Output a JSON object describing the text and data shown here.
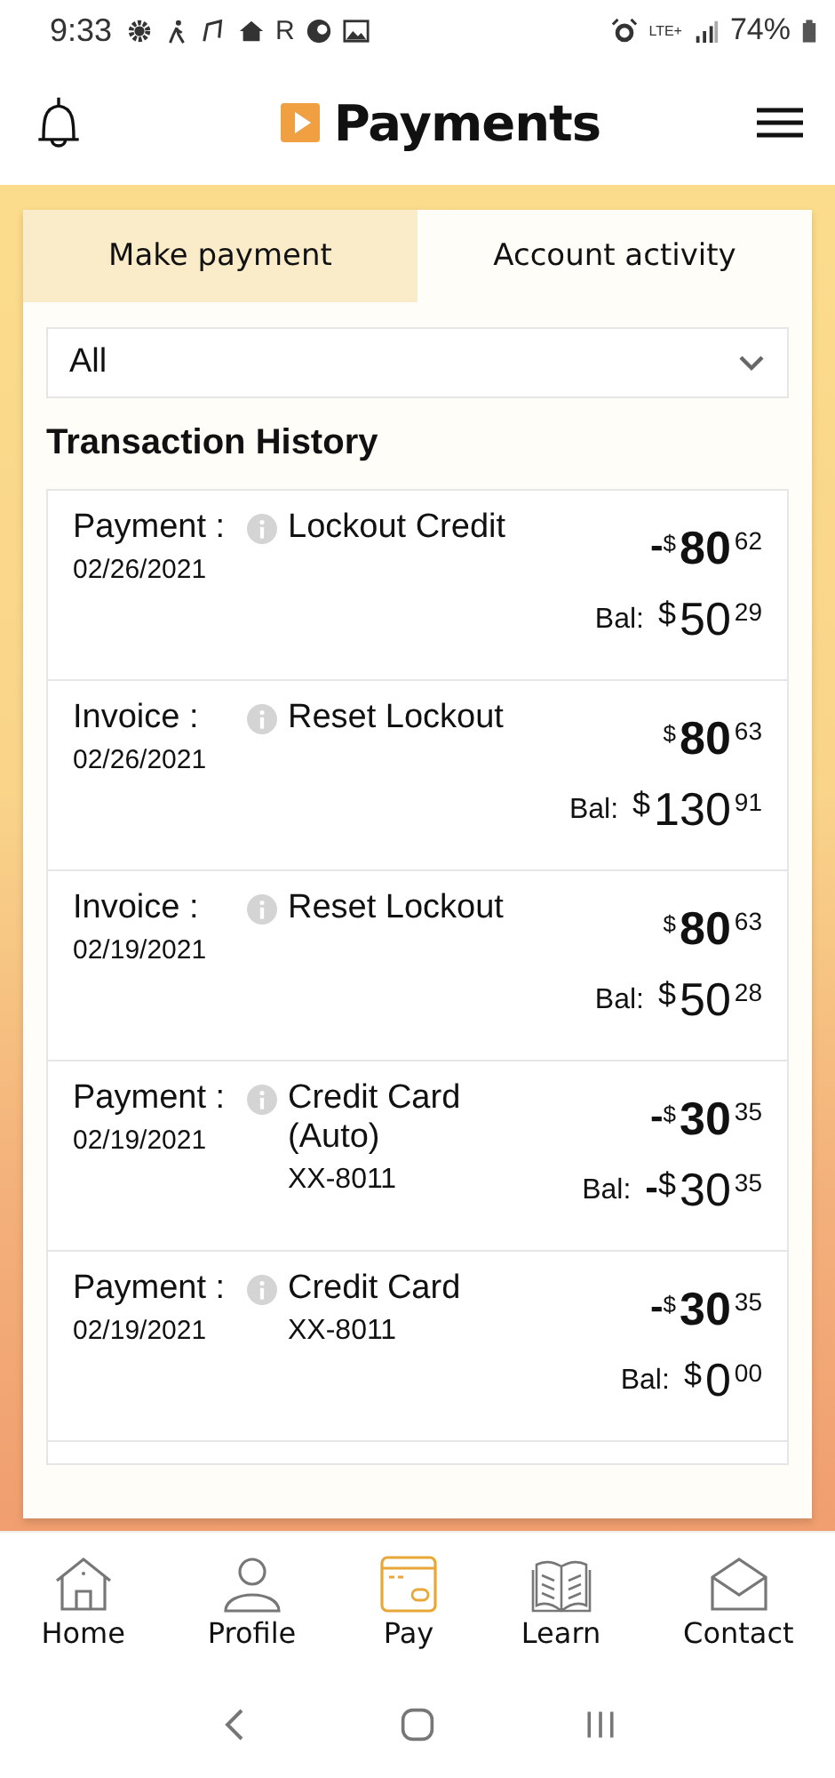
{
  "status_bar": {
    "time": "9:33",
    "carrier_letter": "R",
    "network": "LTE+",
    "battery": "74%"
  },
  "header": {
    "title": "Payments"
  },
  "tabs": [
    {
      "label": "Make payment",
      "selected": false
    },
    {
      "label": "Account activity",
      "selected": true
    }
  ],
  "filter": {
    "value": "All"
  },
  "section_title": "Transaction History",
  "transactions": [
    {
      "type": "Payment :",
      "date": "02/26/2021",
      "description": [
        "Lockout Credit"
      ],
      "amount": {
        "sign": "-",
        "currency": "$",
        "whole": "80",
        "cents": "62"
      },
      "balance_label": "Bal:",
      "balance": {
        "currency": "$",
        "whole": "50",
        "cents": "29"
      }
    },
    {
      "type": "Invoice :",
      "date": "02/26/2021",
      "description": [
        "Reset Lockout"
      ],
      "amount": {
        "currency": "$",
        "whole": "80",
        "cents": "63"
      },
      "balance_label": "Bal:",
      "balance": {
        "currency": "$",
        "whole": "130",
        "cents": "91"
      }
    },
    {
      "type": "Invoice :",
      "date": "02/19/2021",
      "description": [
        "Reset Lockout"
      ],
      "amount": {
        "currency": "$",
        "whole": "80",
        "cents": "63"
      },
      "balance_label": "Bal:",
      "balance": {
        "currency": "$",
        "whole": "50",
        "cents": "28"
      }
    },
    {
      "type": "Payment :",
      "date": "02/19/2021",
      "description": [
        "Credit Card",
        "(Auto)",
        "XX-8011"
      ],
      "amount": {
        "sign": "-",
        "currency": "$",
        "whole": "30",
        "cents": "35"
      },
      "balance_label": "Bal:",
      "balance": {
        "sign": "-",
        "currency": "$",
        "whole": "30",
        "cents": "35"
      }
    },
    {
      "type": "Payment :",
      "date": "02/19/2021",
      "description": [
        "Credit Card",
        "XX-8011"
      ],
      "amount": {
        "sign": "-",
        "currency": "$",
        "whole": "30",
        "cents": "35"
      },
      "balance_label": "Bal:",
      "balance": {
        "currency": "$",
        "whole": "0",
        "cents": "00"
      }
    }
  ],
  "bottom_nav": [
    {
      "label": "Home",
      "selected": false
    },
    {
      "label": "Profile",
      "selected": false
    },
    {
      "label": "Pay",
      "selected": true
    },
    {
      "label": "Learn",
      "selected": false
    },
    {
      "label": "Contact",
      "selected": false
    }
  ]
}
